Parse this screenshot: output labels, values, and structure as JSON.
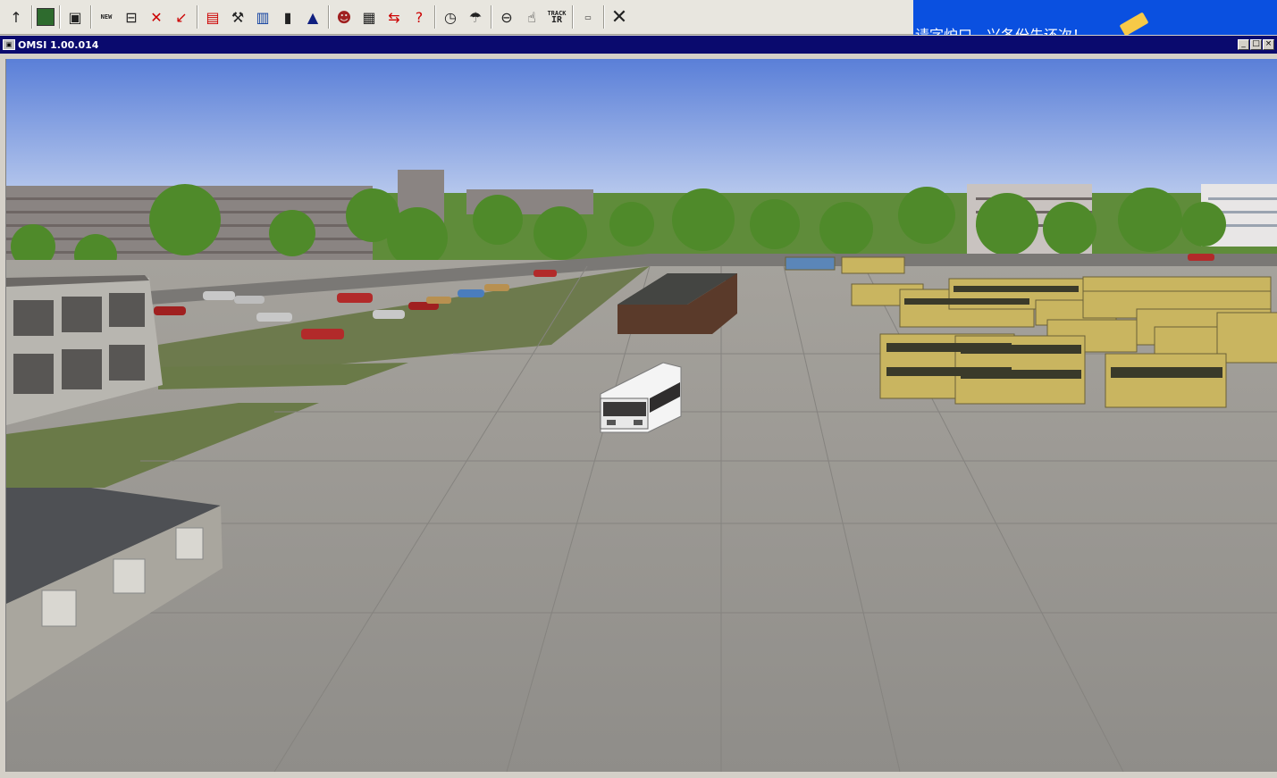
{
  "toolbar": {
    "buttons": [
      {
        "icon": "up-arrow-icon"
      },
      {
        "icon": "map-icon"
      },
      {
        "icon": "save-icon"
      },
      {
        "icon": "new-vehicle-icon",
        "label": "NEW"
      },
      {
        "icon": "vehicle-icon"
      },
      {
        "icon": "delete-vehicle-icon"
      },
      {
        "icon": "repair-icon"
      },
      {
        "icon": "ticket-icon"
      },
      {
        "icon": "wrench-icon"
      },
      {
        "icon": "bus-front-icon"
      },
      {
        "icon": "door-icon"
      },
      {
        "icon": "siren-icon"
      },
      {
        "icon": "driver-icon"
      },
      {
        "icon": "timetable-icon"
      },
      {
        "icon": "route-icon"
      },
      {
        "icon": "help-icon"
      },
      {
        "icon": "clock-icon"
      },
      {
        "icon": "weather-icon"
      },
      {
        "icon": "steering-wheel-icon"
      },
      {
        "icon": "hand-icon"
      },
      {
        "icon": "track-ir-icon",
        "label_top": "TRACK",
        "label_bottom": "IR"
      },
      {
        "icon": "fps-icon"
      },
      {
        "icon": "close-x-icon"
      }
    ]
  },
  "ime": {
    "text": "请字炉口，兴各份先还次！"
  },
  "window": {
    "title": "OMSI 1.00.014",
    "minimize": "_",
    "maximize": "□",
    "close": "×"
  },
  "colors": {
    "sky_top": "#5a7fd8",
    "sky_bottom": "#e6edf7",
    "ground": "#a09f9c",
    "grass": "#6a7a4a",
    "bus_yellow": "#c9b560",
    "bus_white": "#f4f4f4",
    "titlebar": "#0a0a6e",
    "ime_bar": "#0a50e0"
  }
}
